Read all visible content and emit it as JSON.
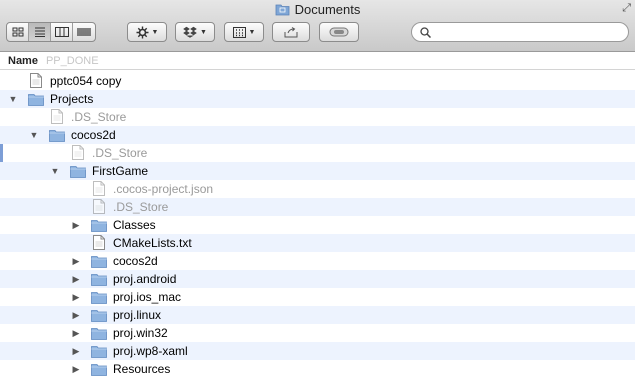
{
  "window": {
    "title": "Documents"
  },
  "toolbar": {
    "search": {
      "value": "",
      "placeholder": ""
    }
  },
  "header": {
    "name_label": "Name",
    "ghost_label": "PP_DONE"
  },
  "rows": [
    {
      "label": "pptc054 copy",
      "indent": 0,
      "type": "doc",
      "expander": "none",
      "dim": false
    },
    {
      "label": "Projects",
      "indent": 0,
      "type": "folder",
      "expander": "open",
      "dim": false
    },
    {
      "label": ".DS_Store",
      "indent": 1,
      "type": "doc",
      "expander": "none",
      "dim": true
    },
    {
      "label": "cocos2d",
      "indent": 1,
      "type": "folder",
      "expander": "open",
      "dim": false
    },
    {
      "label": ".DS_Store",
      "indent": 2,
      "type": "doc",
      "expander": "none",
      "dim": true
    },
    {
      "label": "FirstGame",
      "indent": 2,
      "type": "folder",
      "expander": "open",
      "dim": false
    },
    {
      "label": ".cocos-project.json",
      "indent": 3,
      "type": "doc",
      "expander": "none",
      "dim": true
    },
    {
      "label": ".DS_Store",
      "indent": 3,
      "type": "doc",
      "expander": "none",
      "dim": true
    },
    {
      "label": "Classes",
      "indent": 3,
      "type": "folder",
      "expander": "closed",
      "dim": false
    },
    {
      "label": "CMakeLists.txt",
      "indent": 3,
      "type": "doc",
      "expander": "none",
      "dim": false
    },
    {
      "label": "cocos2d",
      "indent": 3,
      "type": "folder",
      "expander": "closed",
      "dim": false
    },
    {
      "label": "proj.android",
      "indent": 3,
      "type": "folder",
      "expander": "closed",
      "dim": false
    },
    {
      "label": "proj.ios_mac",
      "indent": 3,
      "type": "folder",
      "expander": "closed",
      "dim": false
    },
    {
      "label": "proj.linux",
      "indent": 3,
      "type": "folder",
      "expander": "closed",
      "dim": false
    },
    {
      "label": "proj.win32",
      "indent": 3,
      "type": "folder",
      "expander": "closed",
      "dim": false
    },
    {
      "label": "proj.wp8-xaml",
      "indent": 3,
      "type": "folder",
      "expander": "closed",
      "dim": false
    },
    {
      "label": "Resources",
      "indent": 3,
      "type": "folder",
      "expander": "closed",
      "dim": false
    }
  ],
  "colors": {
    "row_alt": "#edf3fe",
    "folder": "#8fb4e0",
    "dim_text": "#9a9a9a"
  }
}
